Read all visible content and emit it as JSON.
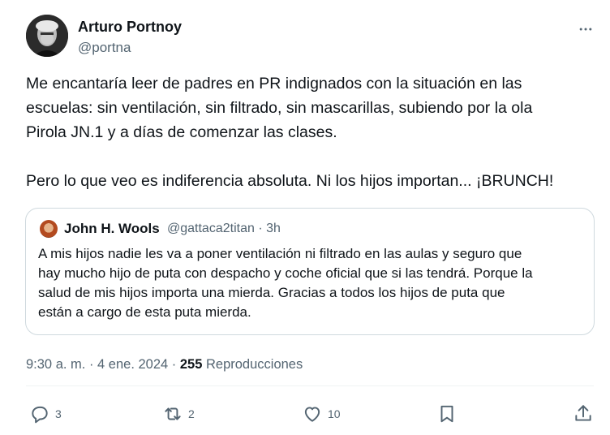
{
  "author": {
    "name": "Arturo Portnoy",
    "handle": "@portna"
  },
  "tweet": {
    "lines_p1": [
      "Me encantaría leer de padres en PR indignados con la situación en las",
      "escuelas: sin ventilación, sin filtrado, sin mascarillas, subiendo por la ola",
      "Pirola JN.1 y a días de comenzar las clases."
    ],
    "line_p2": "Pero lo que veo es indiferencia absoluta. Ni los hijos importan... ¡BRUNCH!"
  },
  "quote": {
    "name": "John H. Wools",
    "meta": "@gattaca2titan · 3h",
    "lines": [
      "A mis hijos nadie les va a poner ventilación ni filtrado en las aulas y seguro que",
      "hay mucho hijo de puta con despacho y coche oficial que si las tendrá. Porque la",
      "salud de mis hijos importa una mierda. Gracias a todos los hijos de puta que",
      "están a cargo de esta puta mierda."
    ]
  },
  "meta": {
    "time_date": "9:30 a. m. · 4 ene. 2024 · ",
    "views_count": "255",
    "views_label": " Reproducciones"
  },
  "actions": {
    "reply_count": "3",
    "retweet_count": "2",
    "like_count": "10"
  },
  "icons": {
    "more": "more-horizontal-icon",
    "reply": "reply-icon",
    "retweet": "retweet-icon",
    "like": "heart-icon",
    "bookmark": "bookmark-icon",
    "share": "share-icon"
  },
  "colors": {
    "text": "#0f1419",
    "secondary": "#536471",
    "border": "#cfd9de"
  }
}
